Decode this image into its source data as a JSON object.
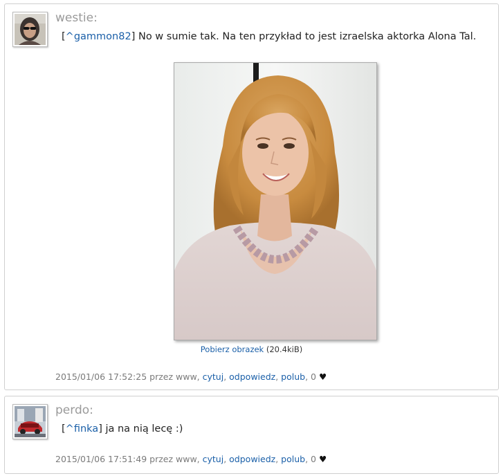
{
  "posts": [
    {
      "username": "westie:",
      "mention": "^gammon82",
      "text": " No w sumie tak. Na ten przykład to jest izraelska aktorka Alona Tal.",
      "download_link": "Pobierz obrazek",
      "download_size": " (20.4kiB)",
      "date": "2015/01/06 17:52:25 przez www, ",
      "actions": {
        "quote": "cytuj",
        "reply": "odpowiedz",
        "like": "polub"
      },
      "likes": "0",
      "heart": "♥",
      "avatar_icon": "user-avatar-sunglasses",
      "image_icon": "photo-actress-portrait"
    },
    {
      "username": "perdo:",
      "mention": "^finka",
      "text": " ja na nią lecę :)",
      "date": "2015/01/06 17:51:49 przez www, ",
      "actions": {
        "quote": "cytuj",
        "reply": "odpowiedz",
        "like": "polub"
      },
      "likes": "0",
      "heart": "♥",
      "avatar_icon": "user-avatar-red-car"
    }
  ],
  "colors": {
    "link": "#1a5fa8",
    "username": "#9a9a9a",
    "meta": "#7a7a7a",
    "border": "#cfcfcf"
  }
}
